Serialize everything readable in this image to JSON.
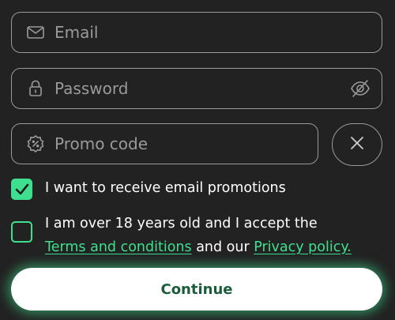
{
  "form": {
    "email": {
      "placeholder": "Email",
      "value": "",
      "icon": "envelope-icon"
    },
    "password": {
      "placeholder": "Password",
      "value": "",
      "icon": "lock-icon",
      "toggle_icon": "eye-off-icon"
    },
    "promo": {
      "placeholder": "Promo code",
      "value": "",
      "icon": "badge-icon",
      "clear_icon": "close-icon"
    },
    "email_promotions": {
      "label": "I want to receive email promotions",
      "checked": true
    },
    "age_terms": {
      "label_line1": "I am over 18 years old and I accept the",
      "terms_link": "Terms and conditions",
      "joiner": " and our ",
      "privacy_link": "Privacy policy.",
      "checked": false
    },
    "continue_label": "Continue"
  },
  "colors": {
    "background": "#222222",
    "accent": "#3ee08f",
    "border": "#9a9a9a",
    "button_text": "#1b5c3a"
  }
}
